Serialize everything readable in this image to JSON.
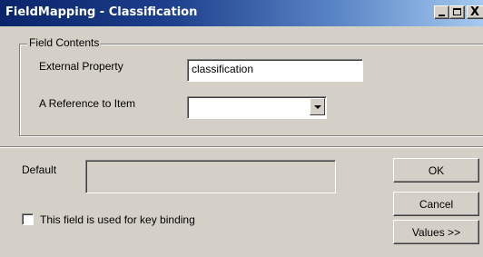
{
  "window": {
    "title": "FieldMapping - Classification",
    "controls": {
      "minimize_icon": "minimize-icon",
      "maximize_icon": "maximize-icon",
      "close_icon": "close-icon",
      "close_glyph": "X"
    }
  },
  "field_contents": {
    "legend": "Field Contents",
    "external_property": {
      "label": "External Property",
      "value": "classification"
    },
    "reference_to_item": {
      "label": "A Reference to Item",
      "selected": ""
    }
  },
  "default": {
    "label": "Default",
    "value": ""
  },
  "key_binding": {
    "label": "This field is used for key binding",
    "checked": false
  },
  "buttons": {
    "ok": "OK",
    "cancel": "Cancel",
    "values": "Values >>"
  }
}
